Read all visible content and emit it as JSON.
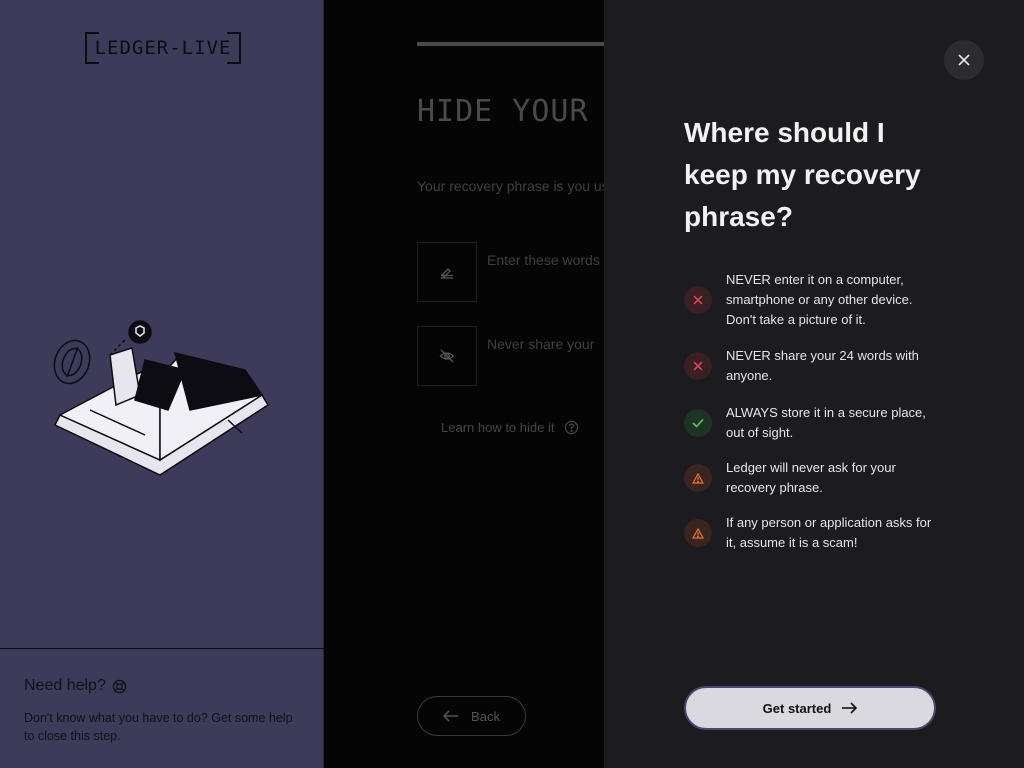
{
  "app": {
    "logo_text": "LEDGER-LIVE"
  },
  "help": {
    "title": "Need help?",
    "text": "Don't know what you have to do? Get some help to close this step."
  },
  "onboarding": {
    "title": "HIDE YOUR R",
    "description": "Your recovery phrase is you use your Nano. You must ke",
    "tips": [
      {
        "icon": "sign-icon",
        "text": "Enter these words smartphones."
      },
      {
        "icon": "eye-off-icon",
        "text": "Never share your"
      }
    ],
    "learn_link": "Learn how to hide it",
    "back_label": "Back"
  },
  "drawer": {
    "title": "Where should I keep my recovery phrase?",
    "rules": [
      {
        "type": "no",
        "icon": "cross-icon",
        "color": "#e24b5c",
        "text": "NEVER enter it on a computer, smartphone or any other device. Don't take a picture of it."
      },
      {
        "type": "no",
        "icon": "cross-icon",
        "color": "#e24b5c",
        "text": "NEVER share your 24 words with anyone."
      },
      {
        "type": "yes",
        "icon": "check-icon",
        "color": "#5fc46b",
        "text": "ALWAYS store it in a secure place, out of sight."
      },
      {
        "type": "warn",
        "icon": "warning-icon",
        "color": "#e8763e",
        "text": "Ledger will never ask for your recovery phrase."
      },
      {
        "type": "warn",
        "icon": "warning-icon",
        "color": "#e8763e",
        "text": "If any person or application asks for it, assume it is a scam!"
      }
    ],
    "cta_label": "Get started"
  },
  "colors": {
    "sidebar_bg": "#3d3a5a",
    "drawer_bg": "#1c1b20",
    "accent": "#4b4670"
  }
}
